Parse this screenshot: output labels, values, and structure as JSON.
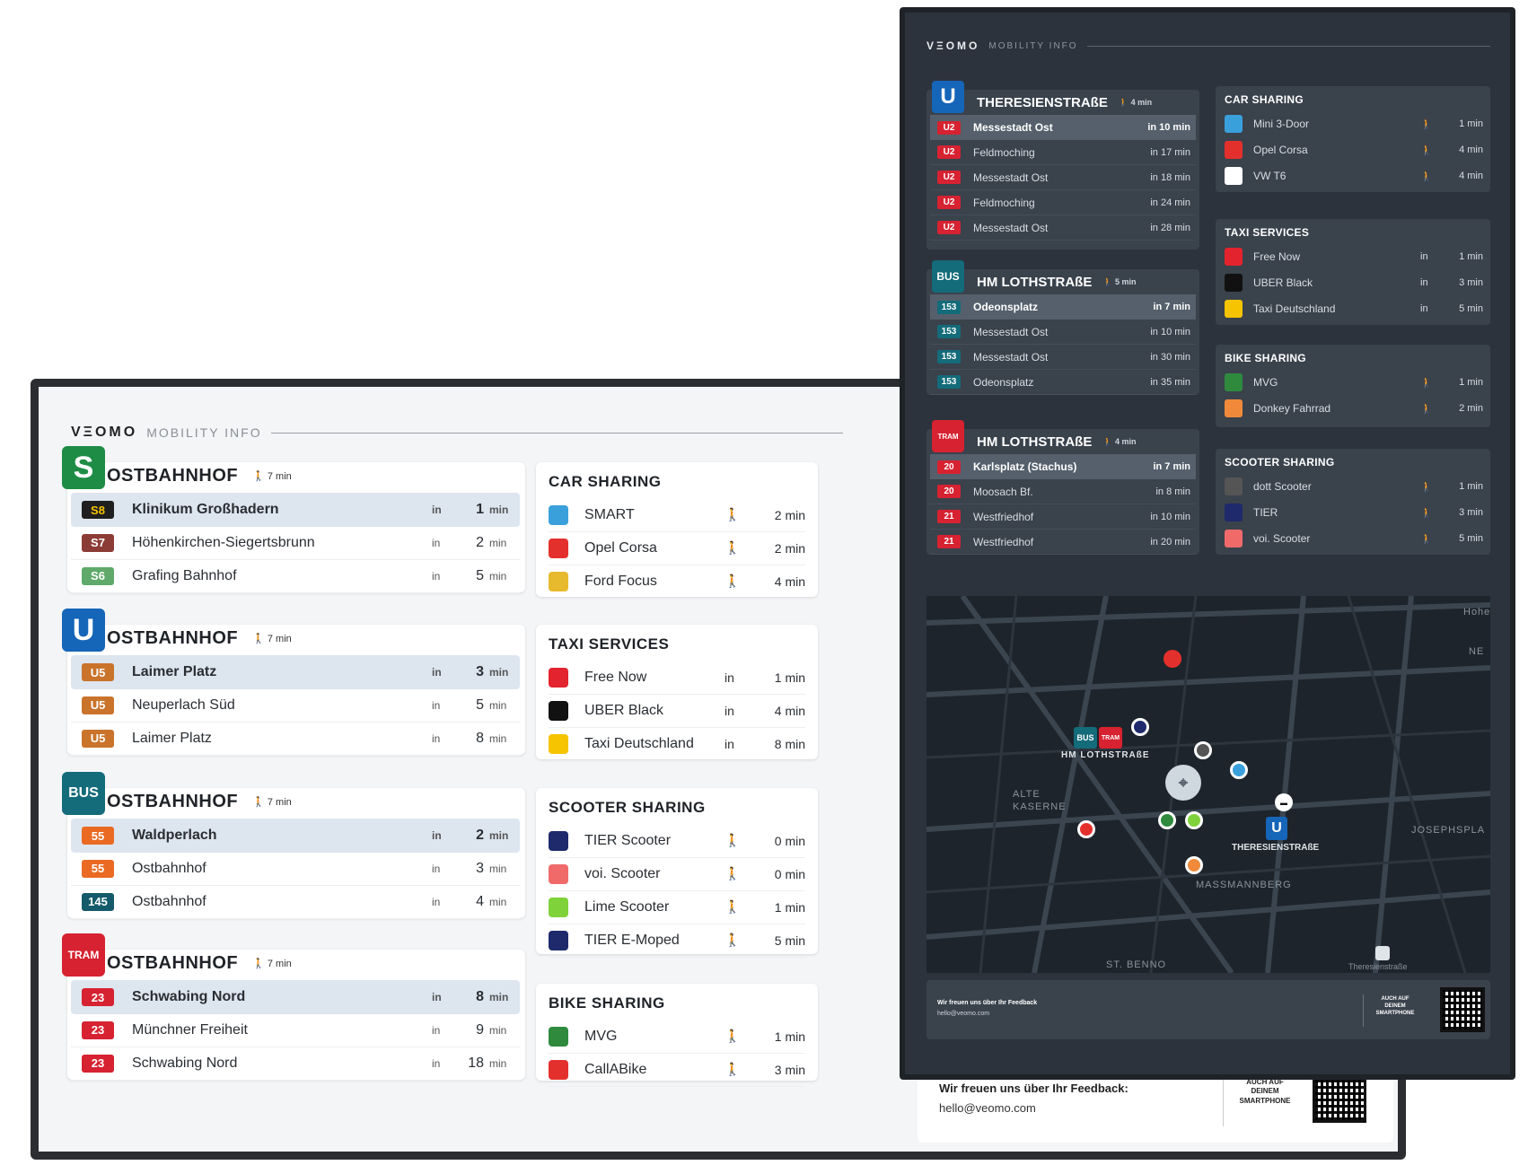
{
  "light": {
    "brand": {
      "logo": "VΞOMO",
      "subtitle": "MOBILITY INFO"
    },
    "stations": [
      {
        "mode": "S",
        "mode_color": "#1e8c45",
        "name": "OSTBAHNHOF",
        "walk": "🚶 7 min",
        "rows": [
          {
            "line": "S8",
            "color": "#1f1f1f",
            "textcolor": "#f5c400",
            "dest": "Klinikum Großhadern",
            "in": "in",
            "min": "1",
            "unit": "min"
          },
          {
            "line": "S7",
            "color": "#8c3c36",
            "textcolor": "#fff",
            "dest": "Höhenkirchen-Siegertsbrunn",
            "in": "in",
            "min": "2",
            "unit": "min"
          },
          {
            "line": "S6",
            "color": "#5fa96a",
            "textcolor": "#fff",
            "dest": "Grafing Bahnhof",
            "in": "in",
            "min": "5",
            "unit": "min"
          }
        ]
      },
      {
        "mode": "U",
        "mode_color": "#1565b8",
        "name": "OSTBAHNHOF",
        "walk": "🚶 7 min",
        "rows": [
          {
            "line": "U5",
            "color": "#c9732b",
            "textcolor": "#fff",
            "dest": "Laimer Platz",
            "in": "in",
            "min": "3",
            "unit": "min"
          },
          {
            "line": "U5",
            "color": "#c9732b",
            "textcolor": "#fff",
            "dest": "Neuperlach Süd",
            "in": "in",
            "min": "5",
            "unit": "min"
          },
          {
            "line": "U5",
            "color": "#c9732b",
            "textcolor": "#fff",
            "dest": "Laimer Platz",
            "in": "in",
            "min": "8",
            "unit": "min"
          }
        ]
      },
      {
        "mode": "BUS",
        "mode_color": "#146b7a",
        "name": "OSTBAHNHOF",
        "walk": "🚶 7 min",
        "rows": [
          {
            "line": "55",
            "color": "#ea6a23",
            "textcolor": "#fff",
            "dest": "Waldperlach",
            "in": "in",
            "min": "2",
            "unit": "min"
          },
          {
            "line": "55",
            "color": "#ea6a23",
            "textcolor": "#fff",
            "dest": "Ostbahnhof",
            "in": "in",
            "min": "3",
            "unit": "min"
          },
          {
            "line": "145",
            "color": "#145a6b",
            "textcolor": "#fff",
            "dest": "Ostbahnhof",
            "in": "in",
            "min": "4",
            "unit": "min"
          }
        ]
      },
      {
        "mode": "TRAM",
        "mode_color": "#d62231",
        "name": "OSTBAHNHOF",
        "walk": "🚶 7 min",
        "rows": [
          {
            "line": "23",
            "color": "#d62231",
            "textcolor": "#fff",
            "dest": "Schwabing Nord",
            "in": "in",
            "min": "8",
            "unit": "min"
          },
          {
            "line": "23",
            "color": "#d62231",
            "textcolor": "#fff",
            "dest": "Münchner Freiheit",
            "in": "in",
            "min": "9",
            "unit": "min"
          },
          {
            "line": "23",
            "color": "#d62231",
            "textcolor": "#fff",
            "dest": "Schwabing Nord",
            "in": "in",
            "min": "18",
            "unit": "min"
          }
        ]
      }
    ],
    "services": [
      {
        "title": "CAR SHARING",
        "rows": [
          {
            "icon": "share-now-icon",
            "color": "#3aa0dc",
            "name": "SMART",
            "walk": "🚶",
            "time": "2 min"
          },
          {
            "icon": "sixt-icon",
            "color": "#e4302d",
            "name": "Opel Corsa",
            "walk": "🚶",
            "time": "2 min"
          },
          {
            "icon": "stattauto-icon",
            "color": "#e7b92c",
            "name": "Ford Focus",
            "walk": "🚶",
            "time": "4 min"
          }
        ]
      },
      {
        "title": "TAXI SERVICES",
        "rows": [
          {
            "icon": "free-now-icon",
            "color": "#e3232d",
            "name": "Free Now",
            "walk": "in",
            "time": "1 min"
          },
          {
            "icon": "uber-icon",
            "color": "#111111",
            "name": "UBER Black",
            "walk": "in",
            "time": "4 min"
          },
          {
            "icon": "taxi-icon",
            "color": "#f6c400",
            "name": "Taxi Deutschland",
            "walk": "in",
            "time": "8 min"
          }
        ]
      },
      {
        "title": "SCOOTER SHARING",
        "rows": [
          {
            "icon": "tier-icon",
            "color": "#1e2a6b",
            "name": "TIER Scooter",
            "walk": "🚶",
            "time": "0 min"
          },
          {
            "icon": "voi-icon",
            "color": "#f06a6a",
            "name": "voi. Scooter",
            "walk": "🚶",
            "time": "0 min"
          },
          {
            "icon": "lime-icon",
            "color": "#7fd23a",
            "name": "Lime Scooter",
            "walk": "🚶",
            "time": "1 min"
          },
          {
            "icon": "tier-icon",
            "color": "#1e2a6b",
            "name": "TIER E-Moped",
            "walk": "🚶",
            "time": "5 min"
          }
        ]
      },
      {
        "title": "BIKE SHARING",
        "rows": [
          {
            "icon": "mvg-icon",
            "color": "#2f8a3e",
            "name": "MVG",
            "walk": "🚶",
            "time": "1 min"
          },
          {
            "icon": "callabike-icon",
            "color": "#e4302d",
            "name": "CallABike",
            "walk": "🚶",
            "time": "3 min"
          }
        ]
      }
    ],
    "footer": {
      "feedback": "Wir freuen uns über Ihr Feedback:",
      "email": "hello@veomo.com",
      "app": "AUCH AUF DEINEM SMARTPHONE"
    }
  },
  "dark": {
    "brand": {
      "logo": "VΞOMO",
      "subtitle": "MOBILITY INFO"
    },
    "stations": [
      {
        "mode": "U",
        "mode_color": "#1565b8",
        "name": "THERESIENSTRAßE",
        "walk": "🚶 4 min",
        "rows": [
          {
            "line": "U2",
            "color": "#d62231",
            "dest": "Messestadt Ost",
            "time": "in 10 min"
          },
          {
            "line": "U2",
            "color": "#d62231",
            "dest": "Feldmoching",
            "time": "in 17 min"
          },
          {
            "line": "U2",
            "color": "#d62231",
            "dest": "Messestadt Ost",
            "time": "in 18 min"
          },
          {
            "line": "U2",
            "color": "#d62231",
            "dest": "Feldmoching",
            "time": "in 24 min"
          },
          {
            "line": "U2",
            "color": "#d62231",
            "dest": "Messestadt Ost",
            "time": "in 28 min"
          }
        ]
      },
      {
        "mode": "BUS",
        "mode_color": "#146b7a",
        "name": "HM LOTHSTRAßE",
        "walk": "🚶 5 min",
        "rows": [
          {
            "line": "153",
            "color": "#146b7a",
            "dest": "Odeonsplatz",
            "time": "in 7 min"
          },
          {
            "line": "153",
            "color": "#146b7a",
            "dest": "Messestadt Ost",
            "time": "in 10 min"
          },
          {
            "line": "153",
            "color": "#146b7a",
            "dest": "Messestadt Ost",
            "time": "in 30 min"
          },
          {
            "line": "153",
            "color": "#146b7a",
            "dest": "Odeonsplatz",
            "time": "in 35 min"
          }
        ]
      },
      {
        "mode": "TRAM",
        "mode_color": "#d62231",
        "name": "HM LOTHSTRAßE",
        "walk": "🚶 4 min",
        "rows": [
          {
            "line": "20",
            "color": "#d62231",
            "dest": "Karlsplatz (Stachus)",
            "time": "in 7 min"
          },
          {
            "line": "20",
            "color": "#d62231",
            "dest": "Moosach Bf.",
            "time": "in 8 min"
          },
          {
            "line": "21",
            "color": "#d62231",
            "dest": "Westfriedhof",
            "time": "in 10 min"
          },
          {
            "line": "21",
            "color": "#d62231",
            "dest": "Westfriedhof",
            "time": "in 20 min"
          }
        ]
      }
    ],
    "services": [
      {
        "title": "CAR SHARING",
        "rows": [
          {
            "icon": "share-now-icon",
            "color": "#3aa0dc",
            "name": "Mini 3-Door",
            "walk": "🚶",
            "time": "1 min"
          },
          {
            "icon": "sixt-icon",
            "color": "#e4302d",
            "name": "Opel Corsa",
            "walk": "🚶",
            "time": "4 min"
          },
          {
            "icon": "miles-icon",
            "color": "#ffffff",
            "name": "VW T6",
            "walk": "🚶",
            "time": "4 min"
          }
        ]
      },
      {
        "title": "TAXI SERVICES",
        "rows": [
          {
            "icon": "free-now-icon",
            "color": "#e3232d",
            "name": "Free Now",
            "walk": "in",
            "time": "1 min"
          },
          {
            "icon": "uber-icon",
            "color": "#111111",
            "name": "UBER Black",
            "walk": "in",
            "time": "3 min"
          },
          {
            "icon": "taxi-icon",
            "color": "#f6c400",
            "name": "Taxi Deutschland",
            "walk": "in",
            "time": "5 min"
          }
        ]
      },
      {
        "title": "BIKE SHARING",
        "rows": [
          {
            "icon": "mvg-icon",
            "color": "#2f8a3e",
            "name": "MVG",
            "walk": "🚶",
            "time": "1 min"
          },
          {
            "icon": "donkey-icon",
            "color": "#f08a3a",
            "name": "Donkey Fahrrad",
            "walk": "🚶",
            "time": "2 min"
          }
        ]
      },
      {
        "title": "SCOOTER SHARING",
        "rows": [
          {
            "icon": "dott-icon",
            "color": "#555555",
            "name": "dott Scooter",
            "walk": "🚶",
            "time": "1 min"
          },
          {
            "icon": "tier-icon",
            "color": "#1e2a6b",
            "name": "TIER",
            "walk": "🚶",
            "time": "3 min"
          },
          {
            "icon": "voi-icon",
            "color": "#f06a6a",
            "name": "voi. Scooter",
            "walk": "🚶",
            "time": "5 min"
          }
        ]
      }
    ],
    "map": {
      "labels": [
        "HM LOTHSTRAßE",
        "ALTE KASERNE",
        "THERESIENSTRAßE",
        "MASSMANNBERG",
        "JOSEPHSPLA",
        "ST. BENNO",
        "Theresienstraße",
        "Hohe",
        "NE"
      ]
    },
    "footer": {
      "feedback": "Wir freuen uns über Ihr Feedback",
      "email": "hello@veomo.com",
      "app": "AUCH AUF DEINEM SMARTPHONE"
    }
  }
}
